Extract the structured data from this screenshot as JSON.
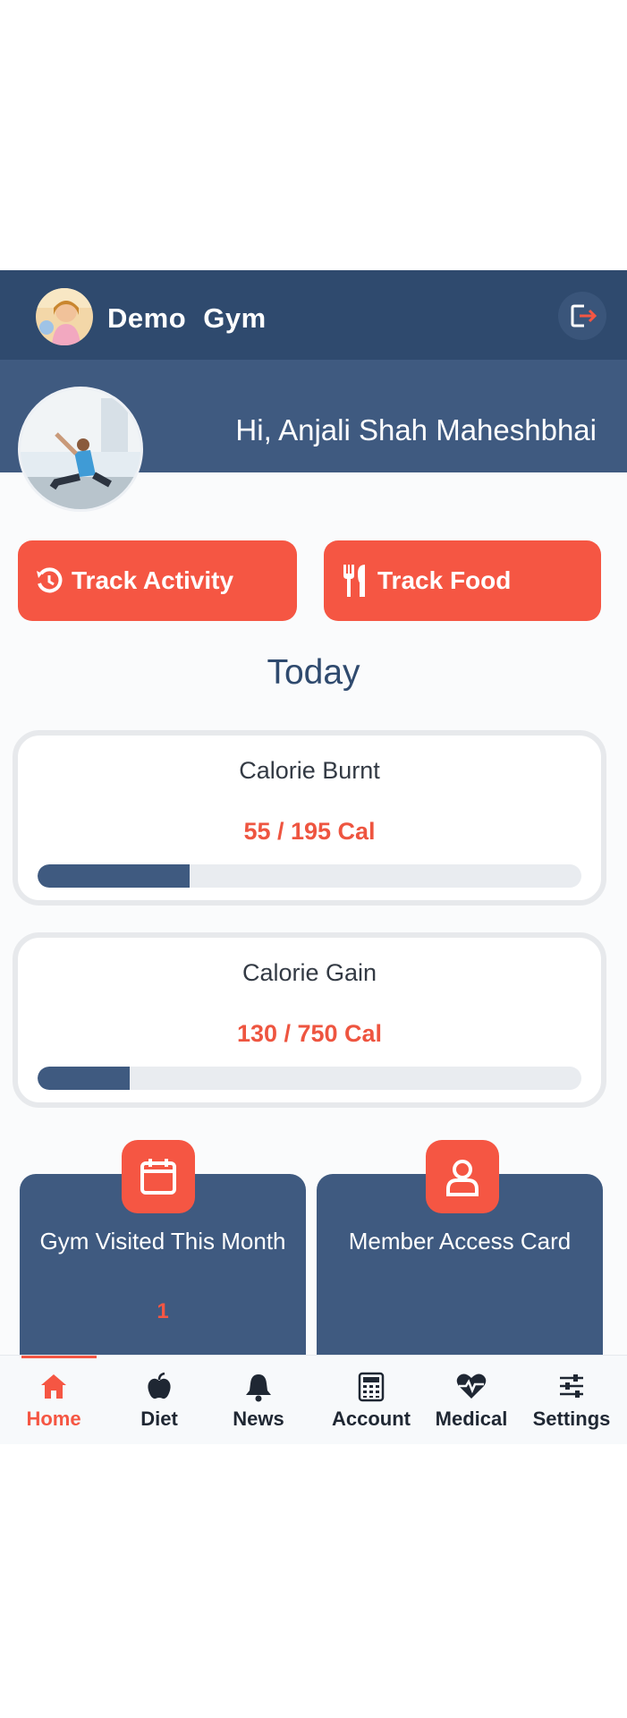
{
  "header": {
    "brand": "Demo Gym",
    "logout_icon": "logout-icon"
  },
  "banner": {
    "greeting": "Hi, Anjali Shah Maheshbhai"
  },
  "actions": {
    "track_activity": "Track Activity",
    "track_food": "Track Food"
  },
  "today_title": "Today",
  "cards": [
    {
      "title": "Calorie Burnt",
      "value_text": "55 / 195 Cal",
      "progress": 0.28
    },
    {
      "title": "Calorie Gain",
      "value_text": "130 / 750 Cal",
      "progress": 0.17
    }
  ],
  "tiles": [
    {
      "label": "Gym Visited This Month",
      "count": "1",
      "icon": "calendar-icon"
    },
    {
      "label": "Member Access Card",
      "icon": "user-icon"
    }
  ],
  "nav": [
    {
      "label": "Home",
      "icon": "home-icon",
      "active": true
    },
    {
      "label": "Diet",
      "icon": "apple-icon"
    },
    {
      "label": "News",
      "icon": "bell-icon"
    },
    {
      "label": "Account",
      "icon": "calculator-icon"
    },
    {
      "label": "Medical",
      "icon": "heartbeat-icon"
    },
    {
      "label": "Settings",
      "icon": "sliders-icon"
    }
  ],
  "colors": {
    "primary": "#2f4a6e",
    "banner": "#3f5a80",
    "accent": "#f55643"
  }
}
